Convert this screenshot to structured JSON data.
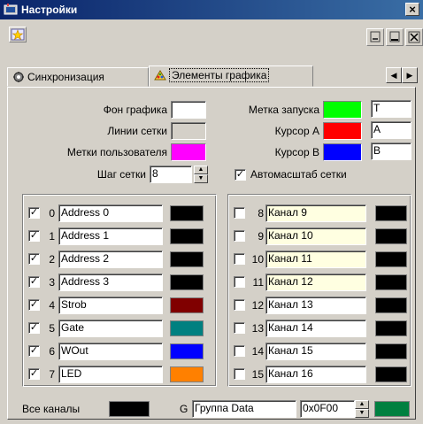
{
  "window": {
    "title": "Настройки"
  },
  "tabs": [
    {
      "label": "Синхронизация"
    },
    {
      "label": "Элементы графика"
    }
  ],
  "settings": {
    "background_label": "Фон графика",
    "grid_lines_label": "Линии сетки",
    "user_marks_label": "Метки пользователя",
    "grid_step_label": "Шаг сетки",
    "grid_step_value": "8",
    "trigger_mark_label": "Метка запуска",
    "trigger_mark_value": "T",
    "cursor_a_label": "Курсор A",
    "cursor_a_value": "A",
    "cursor_b_label": "Курсор B",
    "cursor_b_value": "B",
    "autoscale_label": "Автомасштаб сетки",
    "autoscale_checked": true,
    "colors": {
      "background": "#ffffff",
      "grid_lines": "#d4d0c8",
      "user_marks": "#ff00ff",
      "trigger_mark": "#00ff00",
      "cursor_a": "#ff0000",
      "cursor_b": "#0000ff"
    }
  },
  "channels_left": [
    {
      "num": "0",
      "name": "Address 0",
      "checked": true,
      "color": "#000000"
    },
    {
      "num": "1",
      "name": "Address 1",
      "checked": true,
      "color": "#000000"
    },
    {
      "num": "2",
      "name": "Address 2",
      "checked": true,
      "color": "#000000"
    },
    {
      "num": "3",
      "name": "Address 3",
      "checked": true,
      "color": "#000000"
    },
    {
      "num": "4",
      "name": "Strob",
      "checked": true,
      "color": "#800000"
    },
    {
      "num": "5",
      "name": "Gate",
      "checked": true,
      "color": "#008080"
    },
    {
      "num": "6",
      "name": "WOut",
      "checked": true,
      "color": "#0000ff"
    },
    {
      "num": "7",
      "name": "LED",
      "checked": true,
      "color": "#ff8000"
    }
  ],
  "channels_right": [
    {
      "num": "8",
      "name": "Канал 9",
      "checked": false,
      "color": "#000000",
      "highlight": true
    },
    {
      "num": "9",
      "name": "Канал 10",
      "checked": false,
      "color": "#000000",
      "highlight": true
    },
    {
      "num": "10",
      "name": "Канал 11",
      "checked": false,
      "color": "#000000",
      "highlight": true
    },
    {
      "num": "11",
      "name": "Канал 12",
      "checked": false,
      "color": "#000000",
      "highlight": true
    },
    {
      "num": "12",
      "name": "Канал 13",
      "checked": false,
      "color": "#000000",
      "highlight": false
    },
    {
      "num": "13",
      "name": "Канал 14",
      "checked": false,
      "color": "#000000",
      "highlight": false
    },
    {
      "num": "14",
      "name": "Канал 15",
      "checked": false,
      "color": "#000000",
      "highlight": false
    },
    {
      "num": "15",
      "name": "Канал 16",
      "checked": false,
      "color": "#000000",
      "highlight": false
    }
  ],
  "footer": {
    "all_channels_label": "Все каналы",
    "all_channels_color": "#000000",
    "group_prefix": "G",
    "group_name": "Группа Data",
    "group_mask": "0x0F00",
    "group_color": "#008040"
  }
}
